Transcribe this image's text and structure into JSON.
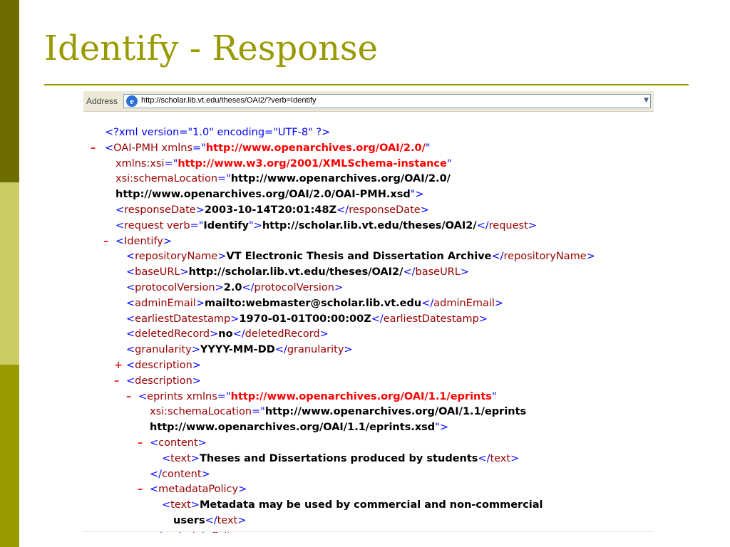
{
  "slide": {
    "title": "Identify - Response"
  },
  "browser": {
    "address_label": "Address",
    "url": "http://scholar.lib.vt.edu/theses/OAI2/?verb=Identify"
  },
  "xml": {
    "declaration": "<?xml version=\"1.0\" encoding=\"UTF-8\" ?>",
    "toggle_collapse": "–",
    "toggle_expand": "+",
    "root_tag": "OAI-PMH",
    "xmlns_attr": "xmlns",
    "xmlns_value": "http://www.openarchives.org/OAI/2.0/",
    "xsi_attr": "xmlns:xsi",
    "xsi_value": "http://www.w3.org/2001/XMLSchema-instance",
    "schema_attr": "xsi:schemaLocation",
    "schema_value_1": "http://www.openarchives.org/OAI/2.0/",
    "schema_value_2": "http://www.openarchives.org/OAI/2.0/OAI-PMH.xsd",
    "responseDate_tag": "responseDate",
    "responseDate_value": "2003-10-14T20:01:48Z",
    "request_tag": "request",
    "request_attr": "verb",
    "request_attr_value": "Identify",
    "request_value": "http://scholar.lib.vt.edu/theses/OAI2/",
    "identify_tag": "Identify",
    "repositoryName_tag": "repositoryName",
    "repositoryName_value": "VT Electronic Thesis and Dissertation Archive",
    "baseURL_tag": "baseURL",
    "baseURL_value": "http://scholar.lib.vt.edu/theses/OAI2/",
    "protocolVersion_tag": "protocolVersion",
    "protocolVersion_value": "2.0",
    "adminEmail_tag": "adminEmail",
    "adminEmail_value": "mailto:webmaster@scholar.lib.vt.edu",
    "earliestDatestamp_tag": "earliestDatestamp",
    "earliestDatestamp_value": "1970-01-01T00:00:00Z",
    "deletedRecord_tag": "deletedRecord",
    "deletedRecord_value": "no",
    "granularity_tag": "granularity",
    "granularity_value": "YYYY-MM-DD",
    "description_tag": "description",
    "eprints_tag": "eprints",
    "eprints_xmlns_attr": "xmlns",
    "eprints_xmlns_value": "http://www.openarchives.org/OAI/1.1/eprints",
    "eprints_schema_attr": "xsi:schemaLocation",
    "eprints_schema_value_1": "http://www.openarchives.org/OAI/1.1/eprints",
    "eprints_schema_value_2": "http://www.openarchives.org/OAI/1.1/eprints.xsd",
    "content_tag": "content",
    "text_tag": "text",
    "content_text_value": "Theses and Dissertations produced by students",
    "metadataPolicy_tag": "metadataPolicy",
    "metadata_text_value_1": "Metadata may be used by commercial and non-commercial",
    "metadata_text_value_2": "users"
  }
}
